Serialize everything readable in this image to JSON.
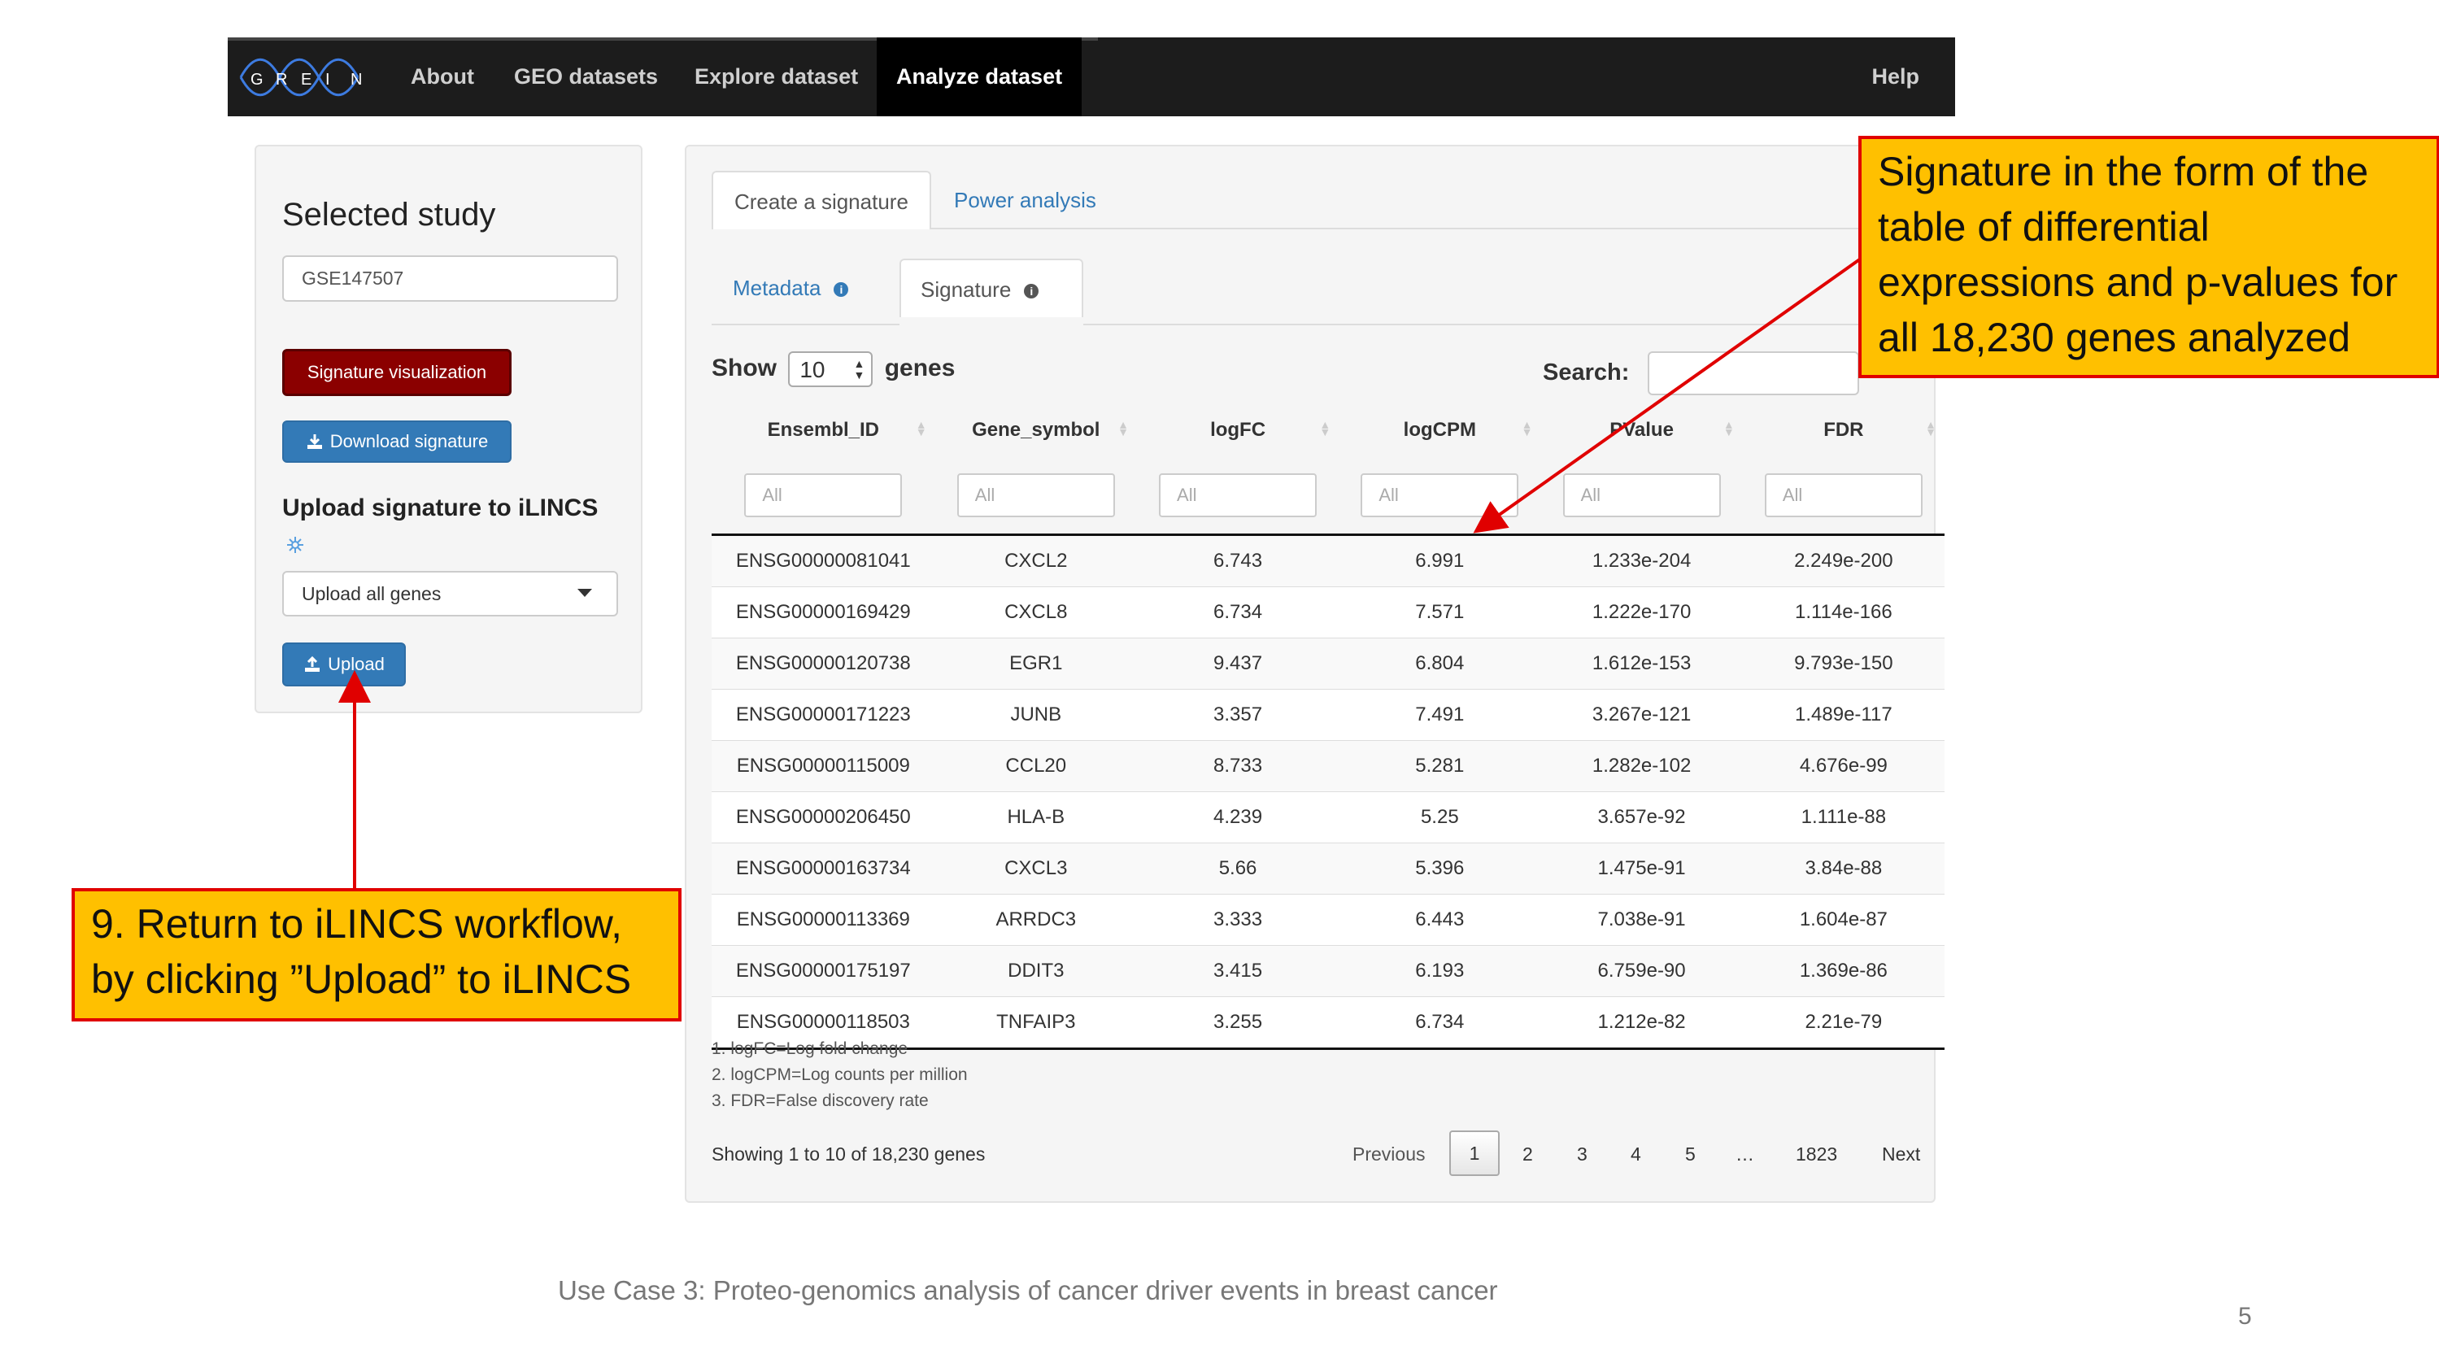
{
  "navbar": {
    "logo_letters": [
      "G",
      "R",
      "E",
      "I",
      "N"
    ],
    "items": [
      "About",
      "GEO datasets",
      "Explore dataset",
      "Analyze dataset"
    ],
    "active": "Analyze dataset",
    "help": "Help"
  },
  "sidebar": {
    "title": "Selected study",
    "study_value": "GSE147507",
    "viz_button": "Signature visualization",
    "download_button": "Download signature",
    "upload_title": "Upload signature to iLINCS",
    "upload_option": "Upload all genes",
    "upload_button": "Upload"
  },
  "main": {
    "tabs": [
      "Create a signature",
      "Power analysis"
    ],
    "subtabs": [
      "Metadata",
      "Signature"
    ],
    "show_label": "Show",
    "show_value": "10",
    "genes_label": "genes",
    "search_label": "Search:",
    "columns": [
      "Ensembl_ID",
      "Gene_symbol",
      "logFC",
      "logCPM",
      "PValue",
      "FDR"
    ],
    "filter_placeholder": "All",
    "rows": [
      [
        "ENSG00000081041",
        "CXCL2",
        "6.743",
        "6.991",
        "1.233e-204",
        "2.249e-200"
      ],
      [
        "ENSG00000169429",
        "CXCL8",
        "6.734",
        "7.571",
        "1.222e-170",
        "1.114e-166"
      ],
      [
        "ENSG00000120738",
        "EGR1",
        "9.437",
        "6.804",
        "1.612e-153",
        "9.793e-150"
      ],
      [
        "ENSG00000171223",
        "JUNB",
        "3.357",
        "7.491",
        "3.267e-121",
        "1.489e-117"
      ],
      [
        "ENSG00000115009",
        "CCL20",
        "8.733",
        "5.281",
        "1.282e-102",
        "4.676e-99"
      ],
      [
        "ENSG00000206450",
        "HLA-B",
        "4.239",
        "5.25",
        "3.657e-92",
        "1.111e-88"
      ],
      [
        "ENSG00000163734",
        "CXCL3",
        "5.66",
        "5.396",
        "1.475e-91",
        "3.84e-88"
      ],
      [
        "ENSG00000113369",
        "ARRDC3",
        "3.333",
        "6.443",
        "7.038e-91",
        "1.604e-87"
      ],
      [
        "ENSG00000175197",
        "DDIT3",
        "3.415",
        "6.193",
        "6.759e-90",
        "1.369e-86"
      ],
      [
        "ENSG00000118503",
        "TNFAIP3",
        "3.255",
        "6.734",
        "1.212e-82",
        "2.21e-79"
      ]
    ],
    "footnotes": [
      "1. logFC=Log fold change",
      "2. logCPM=Log counts per million",
      "3. FDR=False discovery rate"
    ],
    "showing": "Showing 1 to 10 of 18,230 genes",
    "pagination": {
      "previous": "Previous",
      "pages": [
        "1",
        "2",
        "3",
        "4",
        "5",
        "…",
        "1823"
      ],
      "current": "1",
      "next": "Next"
    }
  },
  "annotations": {
    "callout_signature": "Signature in the form of the table of differential expressions and p-values for all 18,230 genes analyzed",
    "callout_upload": "9. Return to iLINCS workflow, by clicking ”Upload” to iLINCS",
    "arrow_color": "#e00000",
    "callout_color": "#ffc000"
  },
  "slide": {
    "caption": "Use Case 3: Proteo-genomics analysis of cancer driver events in breast cancer",
    "page_number": "5"
  },
  "colors": {
    "navbar": "#1c1c1c",
    "viz_button": "#8b0000",
    "primary_button": "#337ab7",
    "link": "#337ab7"
  }
}
